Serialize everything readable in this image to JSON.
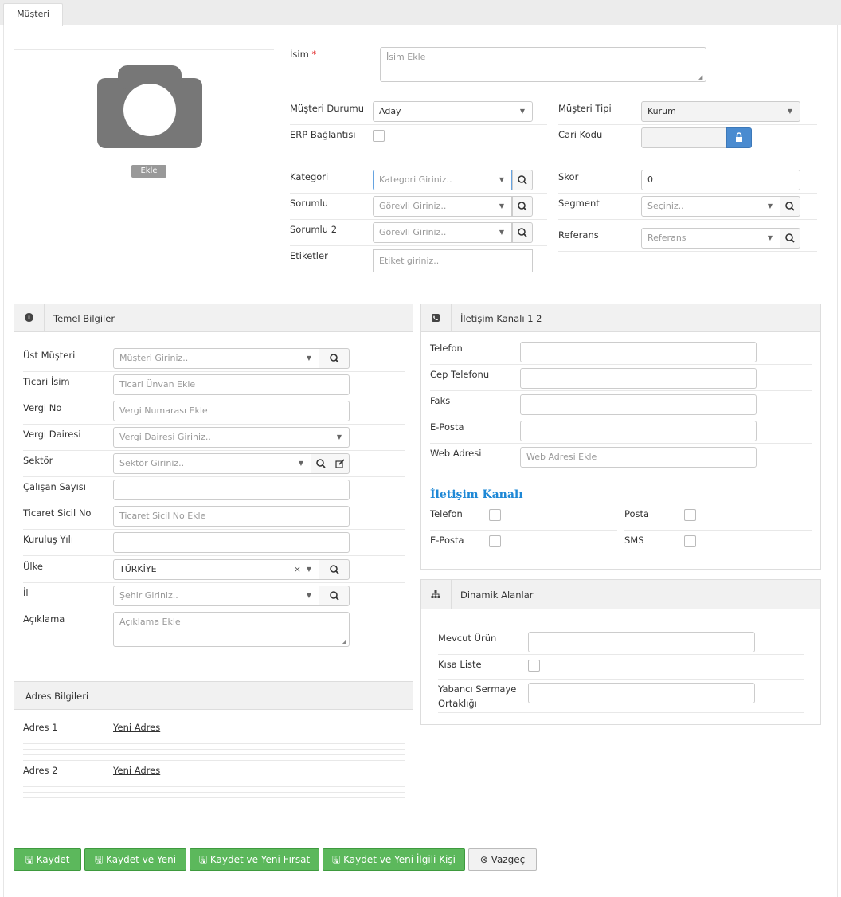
{
  "tab": {
    "label": "Müşteri"
  },
  "photo": {
    "add_label": "Ekle"
  },
  "top": {
    "name_label": "İsim",
    "required_mark": "*",
    "name_placeholder": "İsim Ekle",
    "status_label": "Müşteri Durumu",
    "status_value": "Aday",
    "type_label": "Müşteri Tipi",
    "type_value": "Kurum",
    "erp_label": "ERP Bağlantısı",
    "cari_label": "Cari Kodu",
    "category_label": "Kategori",
    "category_placeholder": "Kategori Giriniz..",
    "score_label": "Skor",
    "score_value": "0",
    "owner_label": "Sorumlu",
    "owner_placeholder": "Görevli Giriniz..",
    "segment_label": "Segment",
    "segment_placeholder": "Seçiniz..",
    "owner2_label": "Sorumlu 2",
    "owner2_placeholder": "Görevli Giriniz..",
    "reference_label": "Referans",
    "reference_placeholder": "Referans",
    "tags_label": "Etiketler",
    "tags_placeholder": "Etiket giriniz.."
  },
  "basic": {
    "title": "Temel Bilgiler",
    "parent_label": "Üst Müşteri",
    "parent_placeholder": "Müşteri Giriniz..",
    "trade_name_label": "Ticari İsim",
    "trade_name_placeholder": "Ticari Ünvan Ekle",
    "tax_no_label": "Vergi No",
    "tax_no_placeholder": "Vergi Numarası Ekle",
    "tax_office_label": "Vergi Dairesi",
    "tax_office_placeholder": "Vergi Dairesi Giriniz..",
    "sector_label": "Sektör",
    "sector_placeholder": "Sektör Giriniz..",
    "employees_label": "Çalışan Sayısı",
    "registry_label": "Ticaret Sicil No",
    "registry_placeholder": "Ticaret Sicil No Ekle",
    "founded_label": "Kuruluş Yılı",
    "country_label": "Ülke",
    "country_value": "TÜRKİYE",
    "city_label": "İl",
    "city_placeholder": "Şehir Giriniz..",
    "desc_label": "Açıklama",
    "desc_placeholder": "Açıklama Ekle"
  },
  "address": {
    "title": "Adres Bilgileri",
    "a1_label": "Adres 1",
    "a1_link": "Yeni Adres",
    "a2_label": "Adres 2",
    "a2_link": "Yeni Adres"
  },
  "contact": {
    "title": "İletişim Kanalı",
    "page1": "1",
    "page2": "2",
    "phone_label": "Telefon",
    "mobile_label": "Cep Telefonu",
    "fax_label": "Faks",
    "email_label": "E-Posta",
    "web_label": "Web Adresi",
    "web_placeholder": "Web Adresi Ekle",
    "channel_title": "İletişim Kanalı",
    "ch_phone": "Telefon",
    "ch_post": "Posta",
    "ch_email": "E-Posta",
    "ch_sms": "SMS"
  },
  "dynamic": {
    "title": "Dinamik Alanlar",
    "product_label": "Mevcut Ürün",
    "shortlist_label": "Kısa Liste",
    "foreign_label_1": "Yabancı Sermaye",
    "foreign_label_2": "Ortaklığı"
  },
  "buttons": {
    "save": "Kaydet",
    "save_new": "Kaydet ve Yeni",
    "save_new_opp": "Kaydet ve Yeni Fırsat",
    "save_new_contact": "Kaydet ve Yeni İlgili Kişi",
    "cancel": "Vazgeç"
  },
  "colors": {
    "accent": "#5cb85c",
    "link_blue": "#1e88d6",
    "lock_button": "#4a8bd0"
  }
}
